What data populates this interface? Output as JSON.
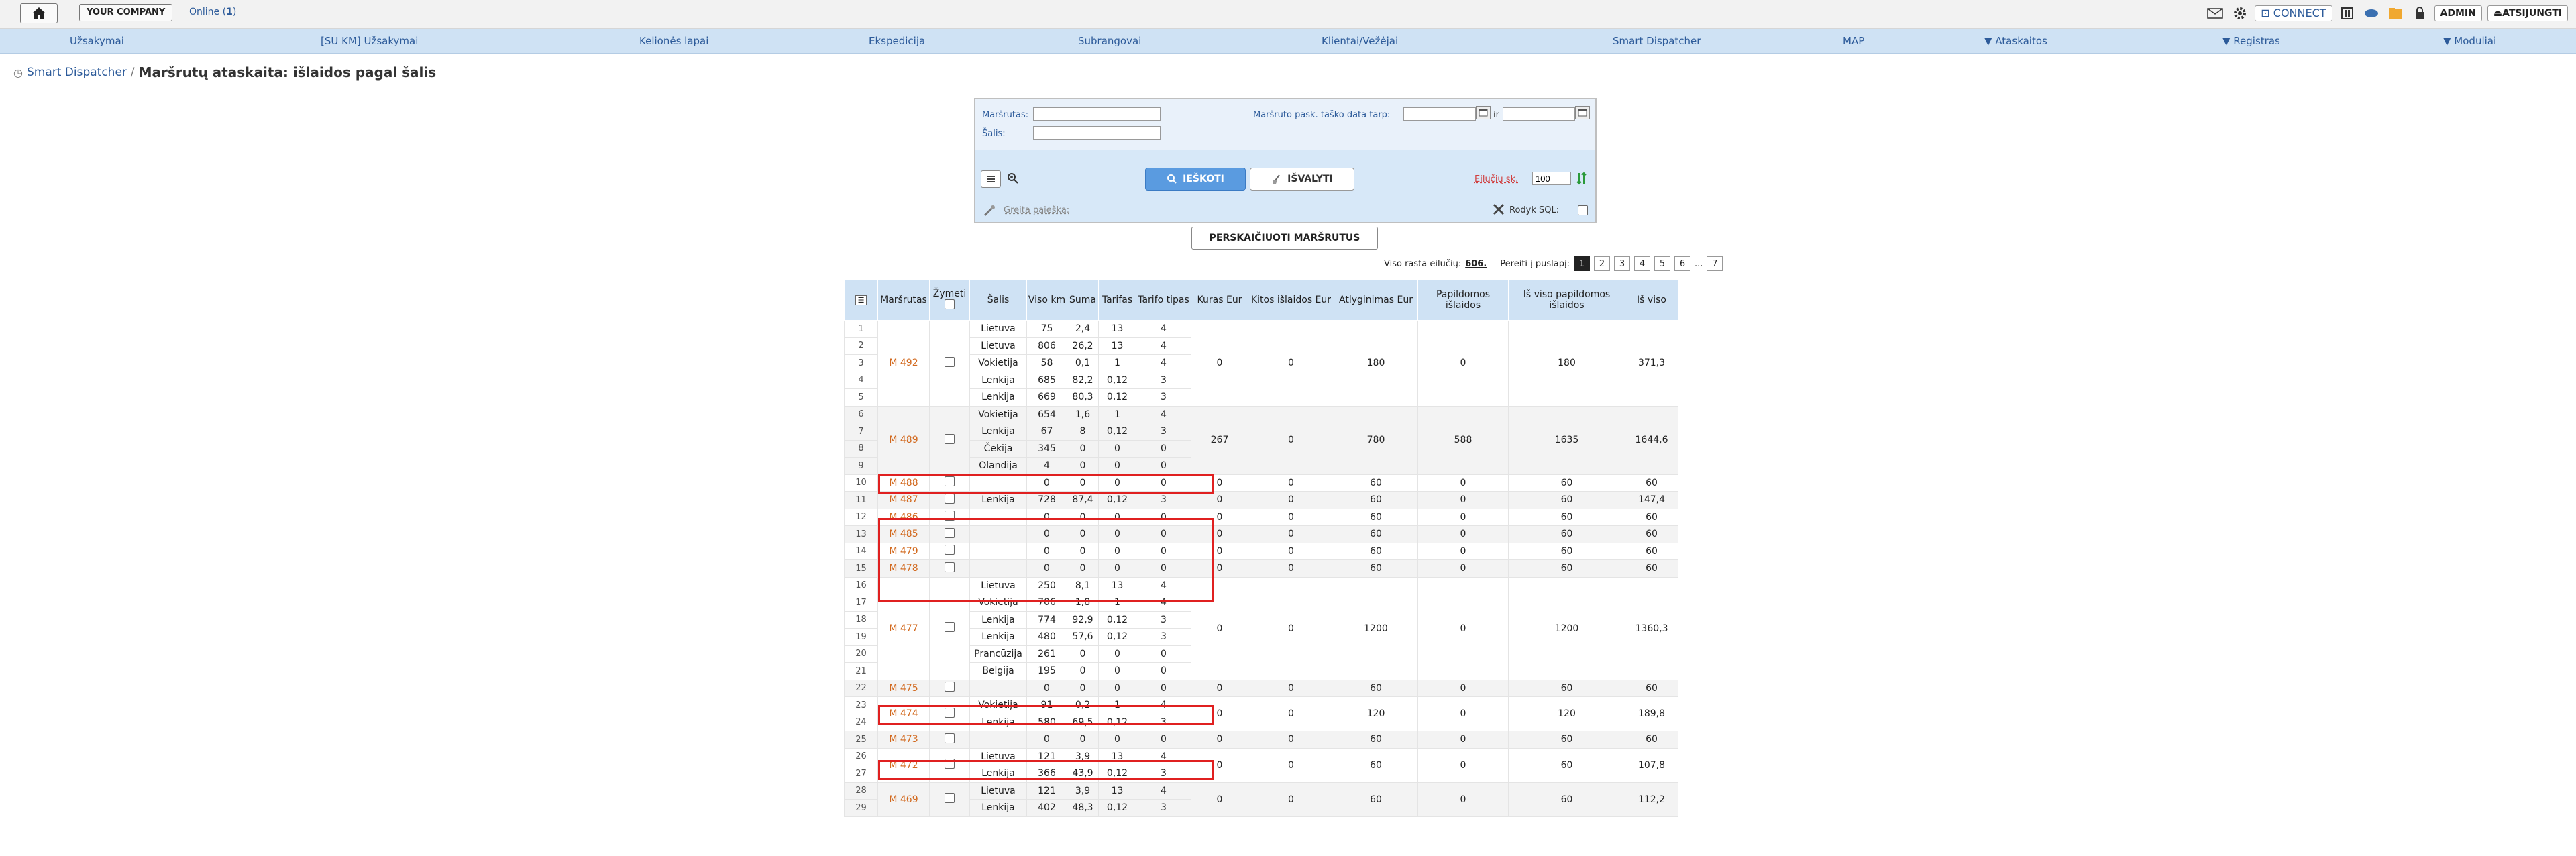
{
  "topbar": {
    "company_label": "YOUR COMPANY",
    "online_label": "Online (",
    "online_count": "1",
    "online_close": ")",
    "connect_label": "CONNECT",
    "admin_label": "ADMIN",
    "logout_label": "ATSIJUNGTI"
  },
  "nav": [
    "Užsakymai",
    "[SU KM] Užsakymai",
    "Kelionės lapai",
    "Ekspedicija",
    "Subrangovai",
    "Klientai/Vežėjai",
    "Smart Dispatcher",
    "MAP",
    "▼ Ataskaitos",
    "▼ Registras",
    "▼ Moduliai"
  ],
  "breadcrumb": {
    "link": "Smart Dispatcher",
    "separator": "/",
    "title": "Maršrutų ataskaita: išlaidos pagal šalis"
  },
  "search": {
    "route_label": "Maršrutas:",
    "country_label": "Šalis:",
    "date_label": "Maršruto pask. taško data tarp:",
    "and_label": "ir",
    "search_button": "IEŠKOTI",
    "clear_button": "IŠVALYTI",
    "rows_label": "Eilučių sk.",
    "rows_value": "100",
    "quick_search": "Greita paieška:",
    "sql_label": "Rodyk SQL:"
  },
  "recalc_button": "PERSKAIČIUOTI MARŠRUTUS",
  "pager": {
    "total_label": "Viso rasta eilučių:",
    "total": "606.",
    "goto_label": "Pereiti į puslapį:",
    "pages": [
      "1",
      "2",
      "3",
      "4",
      "5",
      "6",
      "...",
      "7"
    ]
  },
  "table": {
    "headers": [
      "",
      "Maršrutas",
      "Žymeti",
      "Šalis",
      "Viso km",
      "Suma",
      "Tarifas",
      "Tarifo tipas",
      "Kuras Eur",
      "Kitos išlaidos Eur",
      "Atlyginimas Eur",
      "Papildomos išlaidos",
      "Iš viso papildomos išlaidos",
      "Iš viso"
    ],
    "rows": [
      {
        "n": "1",
        "country": "Lietuva",
        "km": "75",
        "sum": "2,4",
        "tariff": "13",
        "type": "4"
      },
      {
        "n": "2",
        "country": "Lietuva",
        "km": "806",
        "sum": "26,2",
        "tariff": "13",
        "type": "4"
      },
      {
        "n": "3",
        "country": "Vokietija",
        "km": "58",
        "sum": "0,1",
        "tariff": "1",
        "type": "4"
      },
      {
        "n": "4",
        "country": "Lenkija",
        "km": "685",
        "sum": "82,2",
        "tariff": "0,12",
        "type": "3"
      },
      {
        "n": "5",
        "country": "Lenkija",
        "km": "669",
        "sum": "80,3",
        "tariff": "0,12",
        "type": "3"
      },
      {
        "n": "6",
        "country": "Vokietija",
        "km": "654",
        "sum": "1,6",
        "tariff": "1",
        "type": "4"
      },
      {
        "n": "7",
        "country": "Lenkija",
        "km": "67",
        "sum": "8",
        "tariff": "0,12",
        "type": "3"
      },
      {
        "n": "8",
        "country": "Čekija",
        "km": "345",
        "sum": "0",
        "tariff": "0",
        "type": "0"
      },
      {
        "n": "9",
        "country": "Olandija",
        "km": "4",
        "sum": "0",
        "tariff": "0",
        "type": "0"
      },
      {
        "n": "10",
        "country": "",
        "km": "0",
        "sum": "0",
        "tariff": "0",
        "type": "0"
      },
      {
        "n": "11",
        "country": "Lenkija",
        "km": "728",
        "sum": "87,4",
        "tariff": "0,12",
        "type": "3"
      },
      {
        "n": "12",
        "country": "",
        "km": "0",
        "sum": "0",
        "tariff": "0",
        "type": "0"
      },
      {
        "n": "13",
        "country": "",
        "km": "0",
        "sum": "0",
        "tariff": "0",
        "type": "0"
      },
      {
        "n": "14",
        "country": "",
        "km": "0",
        "sum": "0",
        "tariff": "0",
        "type": "0"
      },
      {
        "n": "15",
        "country": "",
        "km": "0",
        "sum": "0",
        "tariff": "0",
        "type": "0"
      },
      {
        "n": "16",
        "country": "Lietuva",
        "km": "250",
        "sum": "8,1",
        "tariff": "13",
        "type": "4"
      },
      {
        "n": "17",
        "country": "Vokietija",
        "km": "706",
        "sum": "1,8",
        "tariff": "1",
        "type": "4"
      },
      {
        "n": "18",
        "country": "Lenkija",
        "km": "774",
        "sum": "92,9",
        "tariff": "0,12",
        "type": "3"
      },
      {
        "n": "19",
        "country": "Lenkija",
        "km": "480",
        "sum": "57,6",
        "tariff": "0,12",
        "type": "3"
      },
      {
        "n": "20",
        "country": "Prancūzija",
        "km": "261",
        "sum": "0",
        "tariff": "0",
        "type": "0"
      },
      {
        "n": "21",
        "country": "Belgija",
        "km": "195",
        "sum": "0",
        "tariff": "0",
        "type": "0"
      },
      {
        "n": "22",
        "country": "",
        "km": "0",
        "sum": "0",
        "tariff": "0",
        "type": "0"
      },
      {
        "n": "23",
        "country": "Vokietija",
        "km": "91",
        "sum": "0,2",
        "tariff": "1",
        "type": "4"
      },
      {
        "n": "24",
        "country": "Lenkija",
        "km": "580",
        "sum": "69,5",
        "tariff": "0,12",
        "type": "3"
      },
      {
        "n": "25",
        "country": "",
        "km": "0",
        "sum": "0",
        "tariff": "0",
        "type": "0"
      },
      {
        "n": "26",
        "country": "Lietuva",
        "km": "121",
        "sum": "3,9",
        "tariff": "13",
        "type": "4"
      },
      {
        "n": "27",
        "country": "Lenkija",
        "km": "366",
        "sum": "43,9",
        "tariff": "0,12",
        "type": "3"
      },
      {
        "n": "28",
        "country": "Lietuva",
        "km": "121",
        "sum": "3,9",
        "tariff": "13",
        "type": "4"
      },
      {
        "n": "29",
        "country": "Lenkija",
        "km": "402",
        "sum": "48,3",
        "tariff": "0,12",
        "type": "3"
      }
    ],
    "groups": [
      {
        "route": "M 492",
        "start": 0,
        "span": 5,
        "fuel": "0",
        "other": "0",
        "salary": "180",
        "extra": "0",
        "extra_total": "180",
        "total": "371,3"
      },
      {
        "route": "M 489",
        "start": 5,
        "span": 4,
        "fuel": "267",
        "other": "0",
        "salary": "780",
        "extra": "588",
        "extra_total": "1635",
        "total": "1644,6"
      },
      {
        "route": "M 488",
        "start": 9,
        "span": 1,
        "fuel": "0",
        "other": "0",
        "salary": "60",
        "extra": "0",
        "extra_total": "60",
        "total": "60"
      },
      {
        "route": "M 487",
        "start": 10,
        "span": 1,
        "fuel": "0",
        "other": "0",
        "salary": "60",
        "extra": "0",
        "extra_total": "60",
        "total": "147,4"
      },
      {
        "route": "M 486",
        "start": 11,
        "span": 1,
        "fuel": "0",
        "other": "0",
        "salary": "60",
        "extra": "0",
        "extra_total": "60",
        "total": "60"
      },
      {
        "route": "M 485",
        "start": 12,
        "span": 1,
        "fuel": "0",
        "other": "0",
        "salary": "60",
        "extra": "0",
        "extra_total": "60",
        "total": "60"
      },
      {
        "route": "M 479",
        "start": 13,
        "span": 1,
        "fuel": "0",
        "other": "0",
        "salary": "60",
        "extra": "0",
        "extra_total": "60",
        "total": "60"
      },
      {
        "route": "M 478",
        "start": 14,
        "span": 1,
        "fuel": "0",
        "other": "0",
        "salary": "60",
        "extra": "0",
        "extra_total": "60",
        "total": "60"
      },
      {
        "route": "M 477",
        "start": 15,
        "span": 6,
        "fuel": "0",
        "other": "0",
        "salary": "1200",
        "extra": "0",
        "extra_total": "1200",
        "total": "1360,3"
      },
      {
        "route": "M 475",
        "start": 21,
        "span": 1,
        "fuel": "0",
        "other": "0",
        "salary": "60",
        "extra": "0",
        "extra_total": "60",
        "total": "60"
      },
      {
        "route": "M 474",
        "start": 22,
        "span": 2,
        "fuel": "0",
        "other": "0",
        "salary": "120",
        "extra": "0",
        "extra_total": "120",
        "total": "189,8"
      },
      {
        "route": "M 473",
        "start": 24,
        "span": 1,
        "fuel": "0",
        "other": "0",
        "salary": "60",
        "extra": "0",
        "extra_total": "60",
        "total": "60"
      },
      {
        "route": "M 472",
        "start": 25,
        "span": 2,
        "fuel": "0",
        "other": "0",
        "salary": "60",
        "extra": "0",
        "extra_total": "60",
        "total": "107,8"
      },
      {
        "route": "M 469",
        "start": 27,
        "span": 2,
        "fuel": "0",
        "other": "0",
        "salary": "60",
        "extra": "0",
        "extra_total": "60",
        "total": "112,2"
      }
    ]
  },
  "colors": {
    "accent": "#2d5b9a",
    "nav_bg": "#cfe2f4",
    "route_link": "#d2691e",
    "highlight": "#e02020"
  }
}
